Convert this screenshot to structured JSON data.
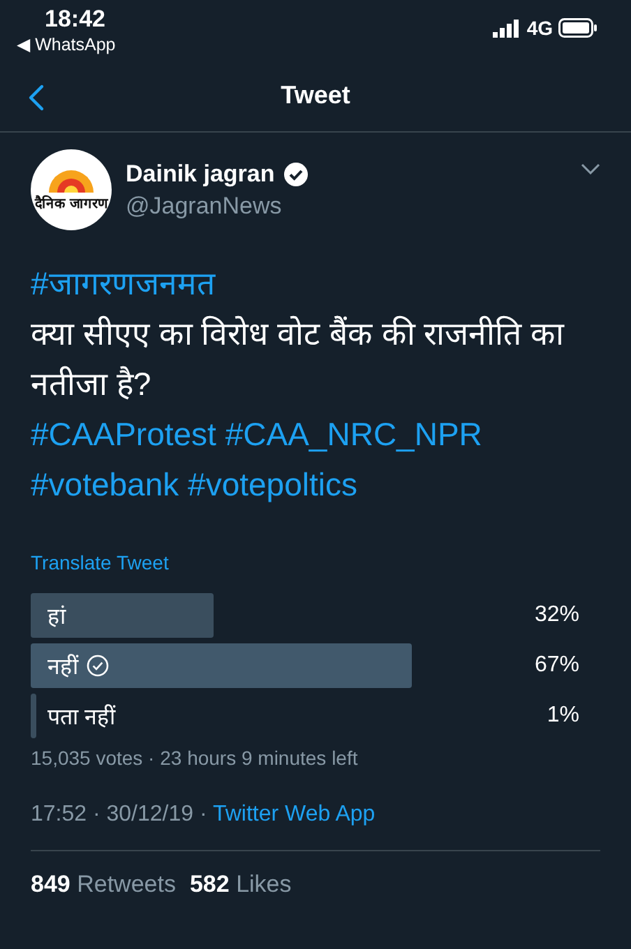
{
  "status_bar": {
    "time": "18:42",
    "back_app": "◀ WhatsApp",
    "network": "4G"
  },
  "nav": {
    "title": "Tweet"
  },
  "author": {
    "name": "Dainik jagran",
    "handle": "@JagranNews",
    "verified": true,
    "logo_text": "दैनिक जागरण"
  },
  "tweet": {
    "hashtag_line": "#जागरणजनमत",
    "text": "क्या सीएए का विरोध वोट बैैंक की राजनीति का नतीजा है?",
    "hashtags": [
      "#CAAProtest",
      "#CAA_NRC_NPR",
      "#votebank",
      "#votepoltics"
    ]
  },
  "translate": "Translate Tweet",
  "poll": {
    "options": [
      {
        "label": "हां",
        "percent": "32%",
        "voted": false
      },
      {
        "label": "नहीं",
        "percent": "67%",
        "voted": true
      },
      {
        "label": "पता नहीं",
        "percent": "1%",
        "voted": false
      }
    ],
    "summary": "15,035 votes · 23 hours 9 minutes left"
  },
  "meta": {
    "time": "17:52 · 30/12/19 · ",
    "source": "Twitter Web App"
  },
  "stats": [
    {
      "count": "849",
      "label": "Retweets"
    },
    {
      "count": "582",
      "label": "Likes"
    }
  ]
}
